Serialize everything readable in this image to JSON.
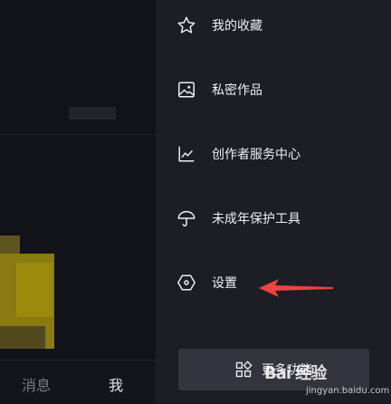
{
  "menu": {
    "items": [
      {
        "label": "我的收藏",
        "icon": "star-icon"
      },
      {
        "label": "私密作品",
        "icon": "image-icon"
      },
      {
        "label": "创作者服务中心",
        "icon": "chart-line-icon"
      },
      {
        "label": "未成年保护工具",
        "icon": "umbrella-icon"
      },
      {
        "label": "设置",
        "icon": "hexagon-settings-icon"
      }
    ],
    "more_button": {
      "label": "更多功能",
      "icon": "grid-icon"
    }
  },
  "bottom_nav": {
    "messages": "消息",
    "me": "我"
  },
  "watermark": {
    "brand": "Bai 经验",
    "url": "jingyan.baidu.com"
  },
  "colors": {
    "drawer_bg": "#1d1d26",
    "arrow": "#e8463f",
    "button_bg": "#34343e"
  }
}
